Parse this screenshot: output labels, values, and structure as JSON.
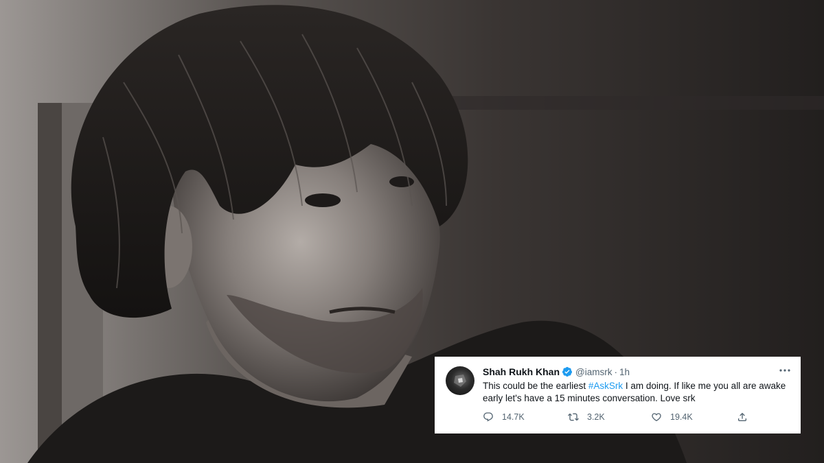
{
  "tweet": {
    "display_name": "Shah Rukh Khan",
    "handle": "@iamsrk",
    "separator": "·",
    "time": "1h",
    "text_before": "This could be the earliest ",
    "hashtag": "#AskSrk",
    "text_after": " I am doing. If like me you all are awake early let's have a 15 minutes conversation. Love srk",
    "replies": "14.7K",
    "retweets": "3.2K",
    "likes": "19.4K",
    "icons": {
      "verified": "verified-badge-icon",
      "more": "more-options-icon",
      "reply": "reply-icon",
      "retweet": "retweet-icon",
      "like": "heart-icon",
      "share": "share-icon"
    },
    "colors": {
      "hashtag": "#1d9bf0",
      "verified": "#1d9bf0",
      "meta": "#536471",
      "text": "#0f1419"
    }
  }
}
